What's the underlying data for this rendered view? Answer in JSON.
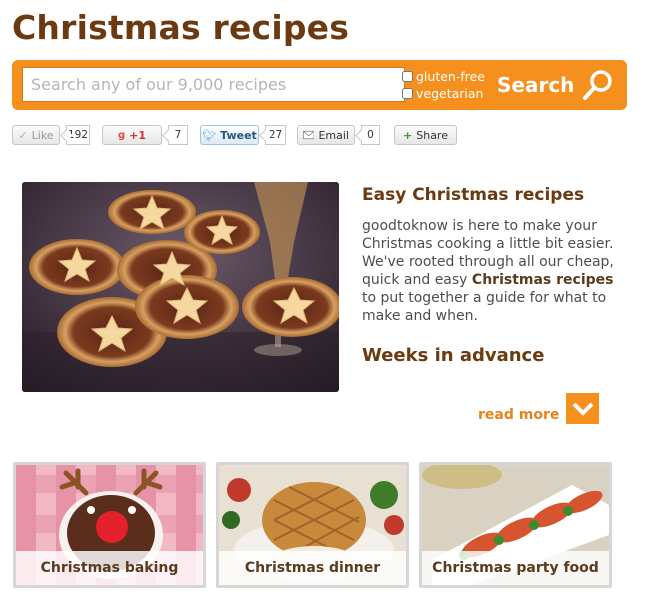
{
  "page": {
    "title": "Christmas recipes"
  },
  "search": {
    "placeholder": "Search any of our 9,000 recipes",
    "value": "",
    "filters": [
      {
        "label": "gluten-free",
        "checked": false
      },
      {
        "label": "vegetarian",
        "checked": false
      }
    ],
    "button_label": "Search",
    "icon": "search-icon"
  },
  "social": {
    "like": {
      "label": "Like",
      "count": "192",
      "icon": "check-icon"
    },
    "gplus": {
      "label": "+1",
      "count": "7",
      "icon": "google-plus-icon"
    },
    "tweet": {
      "label": "Tweet",
      "count": "27",
      "icon": "twitter-bird-icon"
    },
    "email": {
      "label": "Email",
      "count": "0",
      "icon": "envelope-icon"
    },
    "share": {
      "label": "Share",
      "icon": "plus-icon"
    }
  },
  "hero": {
    "title": "Easy Christmas recipes",
    "text_before": "goodtoknow is here to make your Christmas cooking a little bit easier. We've rooted through all our cheap, quick and easy ",
    "text_bold": "Christmas recipes",
    "text_after": " to put together a guide for what to make and when.",
    "subheading": "Weeks in advance",
    "read_more": "read more",
    "read_more_icon": "chevron-down-icon",
    "image_alt": "mince pies photo"
  },
  "cards": [
    {
      "label": "Christmas baking",
      "image": "reindeer-cupcake-photo"
    },
    {
      "label": "Christmas dinner",
      "image": "roast-turkey-photo"
    },
    {
      "label": "Christmas party food",
      "image": "party-canapes-photo"
    }
  ],
  "colors": {
    "brand_orange": "#f5901f",
    "title_brown": "#6b3a10",
    "read_more_orange": "#e8821a"
  }
}
